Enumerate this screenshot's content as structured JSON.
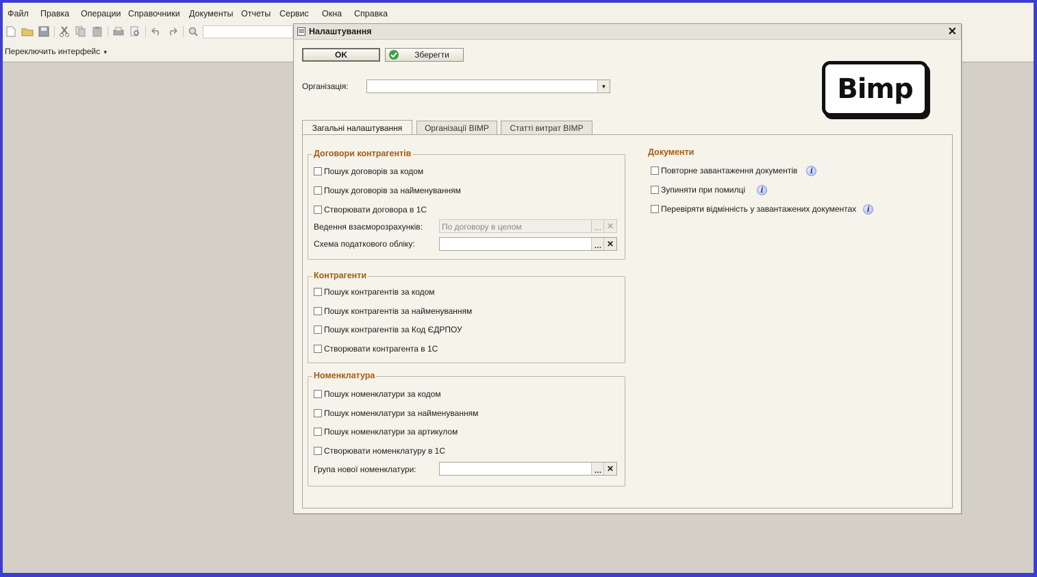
{
  "menu": [
    "Файл",
    "Правка",
    "Операции",
    "Справочники",
    "Документы",
    "Отчеты",
    "Сервис",
    "Окна",
    "Справка"
  ],
  "switch_interface": "Переключить интерфейс",
  "dialog": {
    "title": "Налаштування",
    "ok_label": "OK",
    "save_label": "Зберегти",
    "org_label": "Організація:",
    "org_value": "",
    "logo_text": "Bimp"
  },
  "tabs": [
    "Загальні налаштування",
    "Організації BIMP",
    "Статті витрат BIMP"
  ],
  "contracts": {
    "title": "Договори контрагентів",
    "checks": [
      "Пошук договорів за кодом",
      "Пошук договорів за найменуванням",
      "Створювати договора  в 1С"
    ],
    "settlement_label": "Ведення взаєморозрахунків:",
    "settlement_value": "По договору в целом",
    "tax_label": "Схема податкового обліку:",
    "tax_value": ""
  },
  "counterparties": {
    "title": "Контрагенти",
    "checks": [
      "Пошук контрагентів за кодом",
      "Пошук контрагентів за найменуванням",
      "Пошук контрагентів за Код ЄДРПОУ",
      "Створювати контрагента  в 1С"
    ]
  },
  "nomenclature": {
    "title": "Номенклатура",
    "checks": [
      "Пошук номенклатури за кодом",
      "Пошук номенклатури за найменуванням",
      "Пошук номенклатури за артикулом",
      "Створювати номенклатуру  в 1С"
    ],
    "group_label": "Група нової номенклатури:",
    "group_value": ""
  },
  "documents": {
    "title": "Документи",
    "checks": [
      "Повторне завантаження документів",
      "Зупиняти при помилці",
      "Перевіряти відмінність у завантажених документах"
    ]
  },
  "colors": {
    "frame": "#3b3fd0",
    "section_title": "#a55c12",
    "save_check": "#3aa348"
  }
}
